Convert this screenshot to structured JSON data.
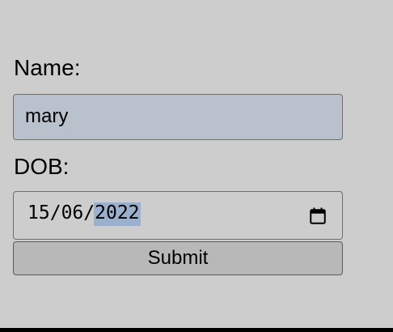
{
  "form": {
    "name_label": "Name:",
    "name_value": "mary",
    "dob_label": "DOB:",
    "dob": {
      "day": "15",
      "month": "06",
      "year": "2022",
      "separator": "/",
      "selected_segment": "year",
      "calendar_icon": "calendar-icon"
    },
    "submit_label": "Submit"
  },
  "colors": {
    "background": "#cdcdcd",
    "name_field_bg": "#b8c1cc",
    "selection_highlight": "#9bb0cd",
    "button_bg": "#b8b8b8"
  }
}
